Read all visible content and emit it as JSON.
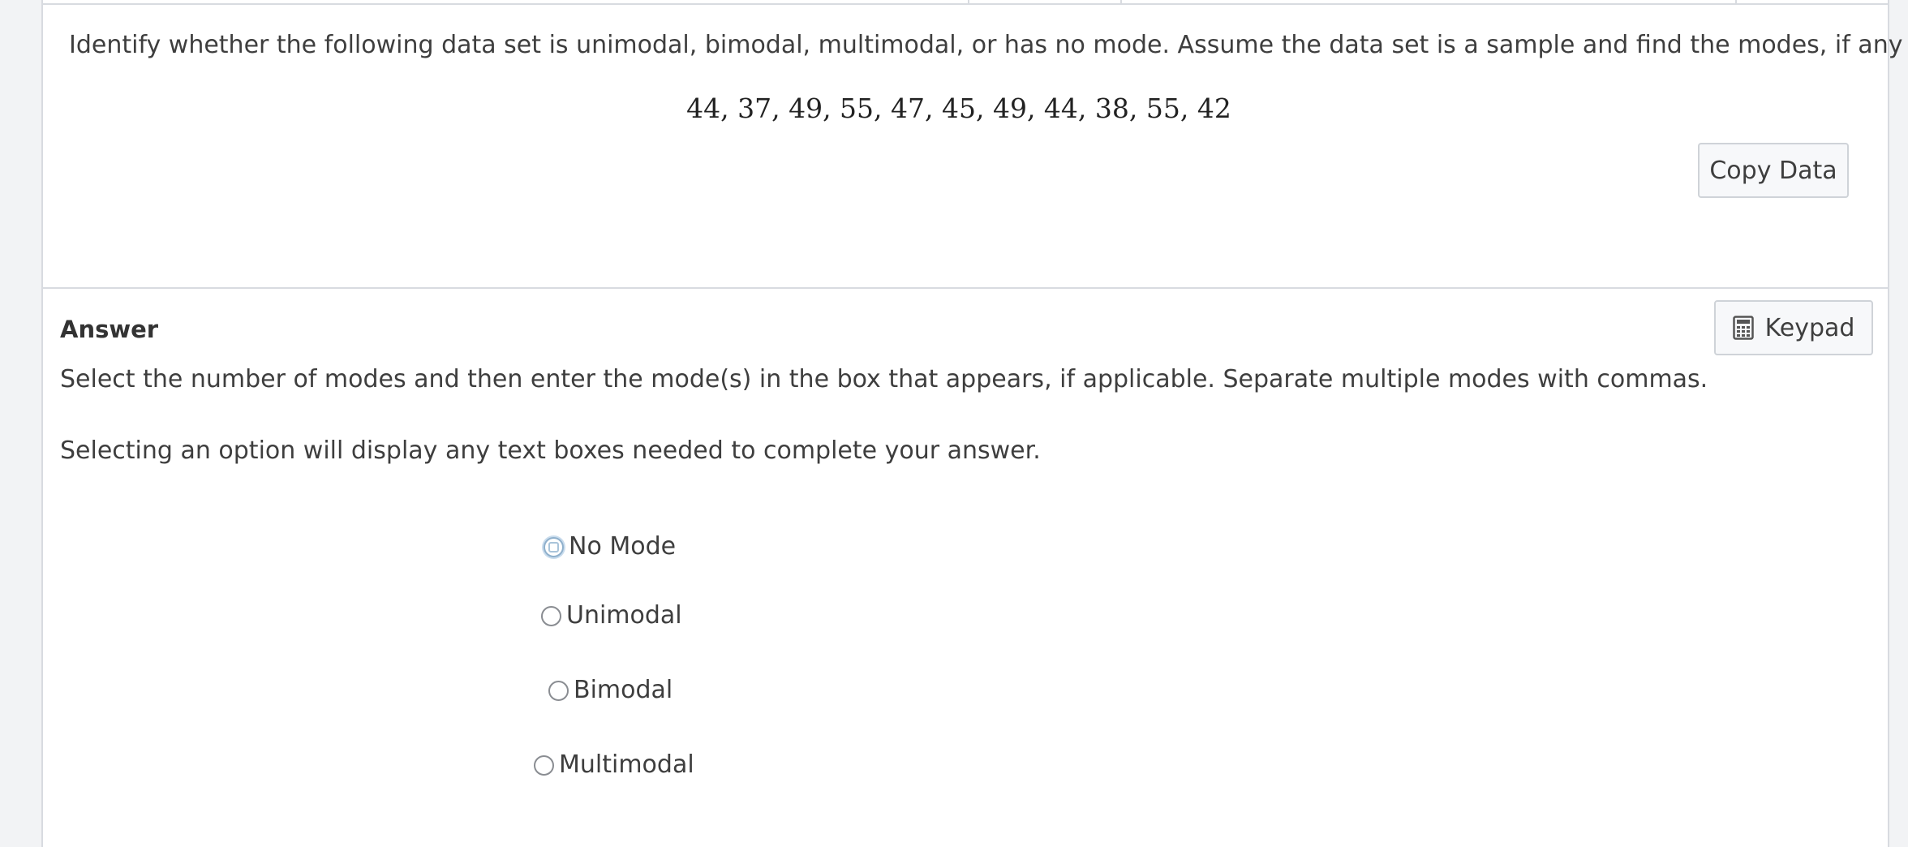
{
  "question": {
    "prompt": "Identify whether the following data set is unimodal, bimodal, multimodal, or has no mode. Assume the data set is a sample and find the modes, if any exist.",
    "dataset": "44, 37, 49, 55, 47, 45, 49, 44, 38, 55, 42",
    "copy_button_label": "Copy Data"
  },
  "answer": {
    "heading": "Answer",
    "keypad_button_label": "Keypad",
    "keypad_icon": "calculator-icon",
    "instruction_1": "Select the number of modes and then enter the mode(s) in the box that appears, if applicable. Separate multiple modes with commas.",
    "instruction_2": "Selecting an option will display any text boxes needed to complete your answer.",
    "options": [
      {
        "label": "No Mode",
        "selected": false
      },
      {
        "label": "Unimodal",
        "selected": false
      },
      {
        "label": "Bimodal",
        "selected": false
      },
      {
        "label": "Multimodal",
        "selected": false
      }
    ]
  }
}
